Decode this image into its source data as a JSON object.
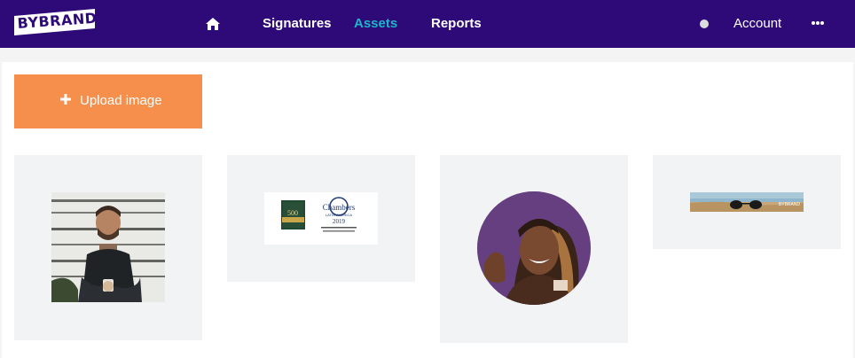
{
  "header": {
    "logo_text": "BYBRAND",
    "nav": {
      "home_icon": "home-icon",
      "signatures": "Signatures",
      "assets": "Assets",
      "reports": "Reports"
    },
    "account_label": "Account",
    "more_icon": "more-horizontal-icon"
  },
  "upload": {
    "label": "Upload image",
    "icon": "plus-icon"
  },
  "colors": {
    "header_bg": "#2e0a78",
    "active_nav": "#19b7c8",
    "upload_bg": "#f58f4b",
    "card_bg": "#f2f3f5"
  },
  "assets": [
    {
      "kind": "photo",
      "subject": "man sitting with mug"
    },
    {
      "kind": "badge",
      "subject": "award badges",
      "badge_text": [
        "500",
        "Chambers",
        "LATIN AMERICA",
        "2019"
      ]
    },
    {
      "kind": "photo",
      "subject": "smiling woman portrait (circular)"
    },
    {
      "kind": "banner",
      "subject": "sunglasses on beach"
    }
  ]
}
